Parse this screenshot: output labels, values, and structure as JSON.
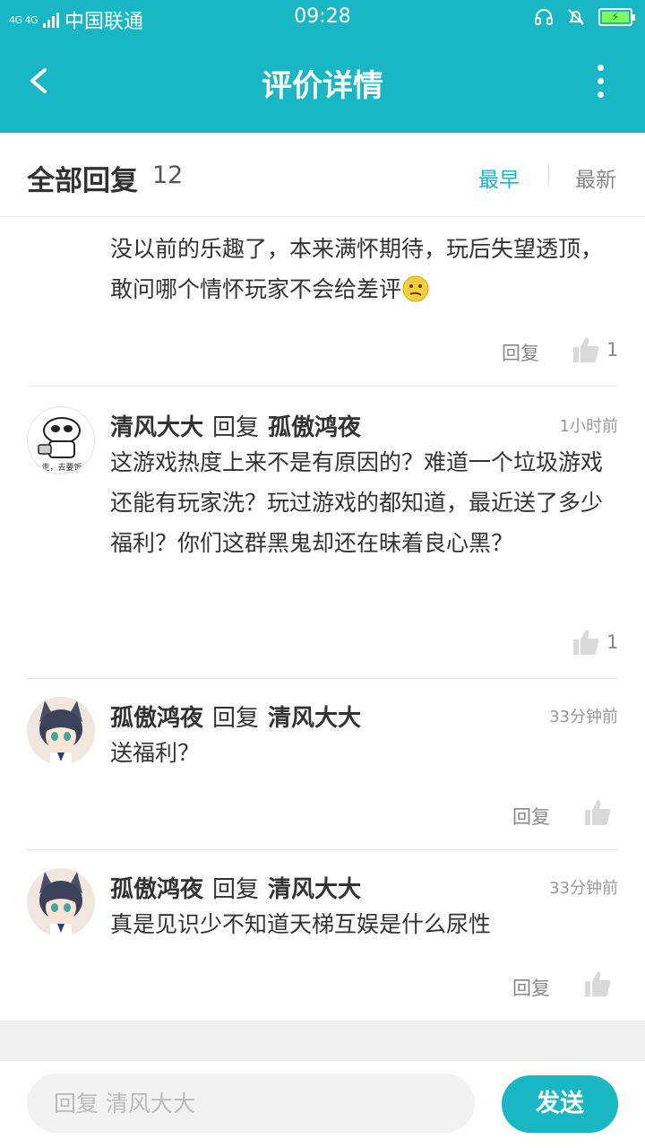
{
  "status_bar": {
    "network": "4G 4G",
    "carrier": "中国联通",
    "time": "09:28",
    "icons": [
      "headset-icon",
      "mute-bell-icon",
      "battery-charging-icon"
    ]
  },
  "app_bar": {
    "title": "评价详情",
    "back_icon": "chevron-left-icon",
    "more_icon": "more-vertical-icon"
  },
  "sort_header": {
    "label": "全部回复",
    "count": "12",
    "sort_earliest": "最早",
    "sort_latest": "最新",
    "active": "最早"
  },
  "comments": [
    {
      "partial": true,
      "text": "没以前的乐趣了，本来满怀期待，玩后失望透顶，敢问哪个情怀玩家不会给差评",
      "emoji": "confused-face",
      "reply_label": "回复",
      "likes": "1"
    },
    {
      "author": "清风大大",
      "reply_word": "回复",
      "target": "孤傲鸿夜",
      "time": "1小时前",
      "avatar_caption": "走，去要饭",
      "text": "这游戏热度上来不是有原因的？难道一个垃圾游戏还能有玩家洗？玩过游戏的都知道，最近送了多少福利？你们这群黑鬼却还在昧着良心黑？",
      "likes": "1"
    },
    {
      "author": "孤傲鸿夜",
      "reply_word": "回复",
      "target": "清风大大",
      "time": "33分钟前",
      "text": "送福利？",
      "reply_label": "回复"
    },
    {
      "author": "孤傲鸿夜",
      "reply_word": "回复",
      "target": "清风大大",
      "time": "33分钟前",
      "text": "真是见识少不知道天梯互娱是什么尿性",
      "reply_label": "回复"
    }
  ],
  "composer": {
    "placeholder": "回复 清风大大",
    "send_label": "发送"
  },
  "colors": {
    "accent": "#19b6c3",
    "text": "#333333",
    "muted": "#999999"
  }
}
